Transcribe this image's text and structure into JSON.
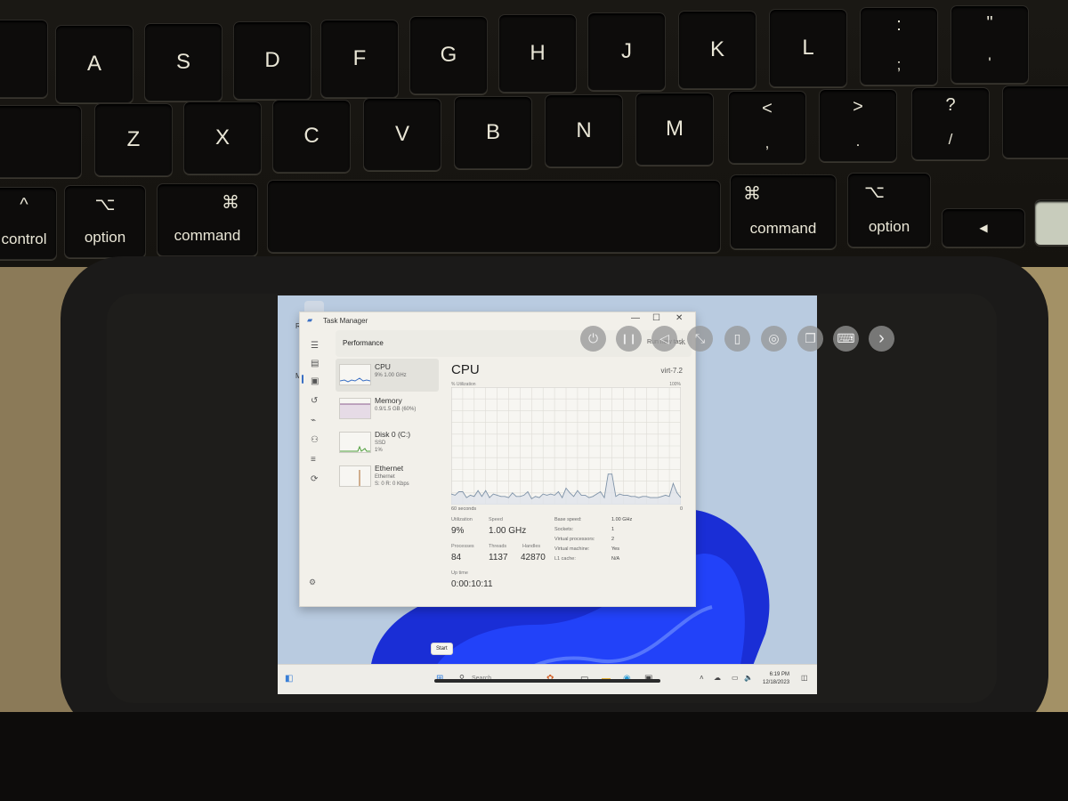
{
  "keyboard": {
    "row2": [
      "A",
      "S",
      "D",
      "F",
      "G",
      "H",
      "J",
      "K",
      "L",
      ";",
      "'"
    ],
    "row2_shift": [
      ":",
      "\""
    ],
    "row3": [
      "Z",
      "X",
      "C",
      "V",
      "B",
      "N",
      "M",
      ",",
      ".",
      "/"
    ],
    "row3_shift": [
      "<",
      ">",
      "?"
    ],
    "modifiers": {
      "control": {
        "symbol": "^",
        "label": "control"
      },
      "option_left": {
        "symbol": "⌥",
        "label": "option"
      },
      "command_left": {
        "symbol": "⌘",
        "label": "command"
      },
      "command_right": {
        "symbol": "⌘",
        "label": "command"
      },
      "option_right": {
        "symbol": "⌥",
        "label": "option"
      },
      "arrow_left": "◀"
    }
  },
  "vm_toolbar": {
    "buttons": [
      {
        "name": "power",
        "icon": "power-icon",
        "glyph": "⏻"
      },
      {
        "name": "pause",
        "icon": "pause-icon",
        "glyph": "❙❙"
      },
      {
        "name": "back",
        "icon": "back-icon",
        "glyph": "◁"
      },
      {
        "name": "shrink",
        "icon": "shrink-icon",
        "glyph": "⤡"
      },
      {
        "name": "usb",
        "icon": "usb-icon",
        "glyph": "▯"
      },
      {
        "name": "drive",
        "icon": "disc-icon",
        "glyph": "◎"
      },
      {
        "name": "windows",
        "icon": "windows-icon",
        "glyph": "❐"
      },
      {
        "name": "keyboard",
        "icon": "keyboard-icon",
        "glyph": "⌨"
      },
      {
        "name": "next",
        "icon": "chevron-right-icon",
        "glyph": "›"
      }
    ]
  },
  "desktop": {
    "icons": [
      {
        "label": "Rec"
      },
      {
        "label": "Mic E"
      }
    ]
  },
  "task_manager": {
    "title": "Task Manager",
    "window_controls": {
      "minimize": "—",
      "maximize": "☐",
      "close": "✕"
    },
    "header": {
      "title": "Performance",
      "run_task": "Run new task",
      "more": "..."
    },
    "sidebar": [
      {
        "name": "CPU",
        "sub": [
          "9% 1.00 GHz"
        ],
        "color": "#3a6fc4",
        "active": true
      },
      {
        "name": "Memory",
        "sub": [
          "0.9/1.5 GB (60%)"
        ],
        "color": "#8c5f8f",
        "active": false
      },
      {
        "name": "Disk 0 (C:)",
        "sub": [
          "SSD",
          "1%"
        ],
        "color": "#4d9e3a",
        "active": false
      },
      {
        "name": "Ethernet",
        "sub": [
          "Ethernet",
          "S: 0 R: 0 Kbps"
        ],
        "color": "#a8652a",
        "active": false
      }
    ],
    "cpu": {
      "title": "CPU",
      "model": "virt-7.2",
      "utilization_label": "% Utilization",
      "max_label": "100%",
      "time_label": "60 seconds",
      "zero_label": "0",
      "stats": {
        "utilization": {
          "label": "Utilization",
          "value": "9%"
        },
        "speed": {
          "label": "Speed",
          "value": "1.00 GHz"
        },
        "processes": {
          "label": "Processes",
          "value": "84"
        },
        "threads": {
          "label": "Threads",
          "value": "1137"
        },
        "handles": {
          "label": "Handles",
          "value": "42870"
        },
        "uptime": {
          "label": "Up time",
          "value": "0:00:10:11"
        }
      },
      "specs": [
        {
          "label": "Base speed:",
          "value": "1.00 GHz"
        },
        {
          "label": "Sockets:",
          "value": "1"
        },
        {
          "label": "Virtual processors:",
          "value": "2"
        },
        {
          "label": "Virtual machine:",
          "value": "Yes"
        },
        {
          "label": "L1 cache:",
          "value": "N/A"
        }
      ]
    }
  },
  "chart_data": {
    "type": "area",
    "title": "CPU",
    "xlabel": "60 seconds",
    "ylabel": "% Utilization",
    "xlim": [
      60,
      0
    ],
    "ylim": [
      0,
      100
    ],
    "grid": true,
    "x": [
      60,
      59,
      58,
      57,
      56,
      55,
      54,
      53,
      52,
      51,
      50,
      49,
      48,
      47,
      46,
      45,
      44,
      43,
      42,
      41,
      40,
      39,
      38,
      37,
      36,
      35,
      34,
      33,
      32,
      31,
      30,
      29,
      28,
      27,
      26,
      25,
      24,
      23,
      22,
      21,
      20,
      19,
      18,
      17,
      16,
      15,
      14,
      13,
      12,
      11,
      10,
      9,
      8,
      7,
      6,
      5,
      4,
      3,
      2,
      1,
      0
    ],
    "series": [
      {
        "name": "CPU",
        "values": [
          9,
          8,
          11,
          11,
          6,
          8,
          7,
          12,
          7,
          12,
          6,
          9,
          8,
          7,
          7,
          6,
          10,
          7,
          7,
          8,
          11,
          5,
          7,
          6,
          9,
          8,
          9,
          8,
          11,
          6,
          14,
          10,
          7,
          12,
          8,
          8,
          6,
          7,
          9,
          11,
          6,
          26,
          26,
          7,
          9,
          8,
          8,
          7,
          7,
          6,
          7,
          7,
          6,
          6,
          6,
          7,
          8,
          7,
          18,
          10,
          6
        ]
      }
    ],
    "color": "#3a6fc4"
  },
  "taskbar": {
    "start_tooltip": "Start",
    "search_placeholder": "Search",
    "time": "6:19 PM",
    "date": "12/18/2023"
  }
}
